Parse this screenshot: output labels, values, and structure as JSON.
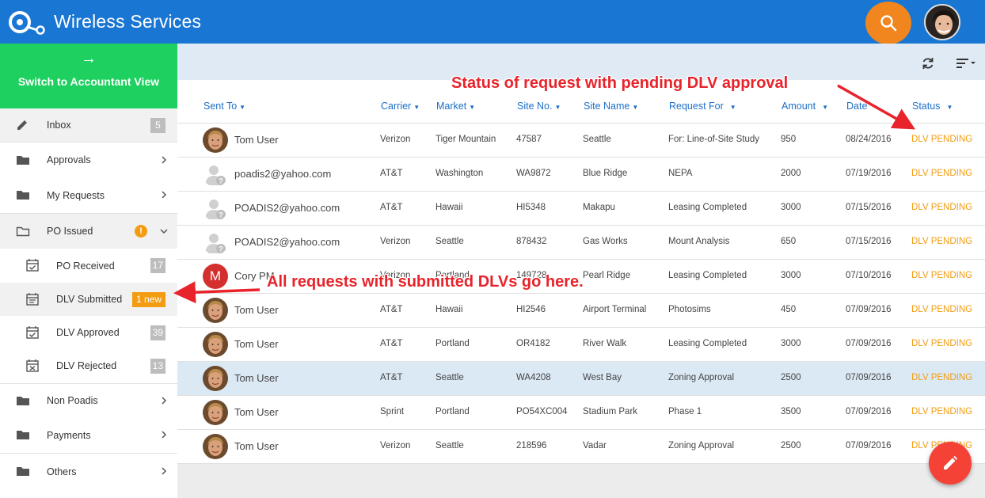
{
  "app": {
    "title": "Wireless Services"
  },
  "sidebar": {
    "switch_label": "Switch to Accountant View",
    "switch_arrow": "→",
    "items": [
      {
        "label": "Inbox",
        "count": "5"
      },
      {
        "label": "Approvals"
      },
      {
        "label": "My Requests"
      },
      {
        "label": "PO Issued",
        "warning": "!"
      },
      {
        "label": "PO Received",
        "count": "17"
      },
      {
        "label": "DLV Submitted",
        "badge": "1 new"
      },
      {
        "label": "DLV Approved",
        "count": "39"
      },
      {
        "label": "DLV Rejected",
        "count": "13"
      },
      {
        "label": "Non Poadis"
      },
      {
        "label": "Payments"
      },
      {
        "label": "Others"
      }
    ]
  },
  "table": {
    "columns": [
      "Sent To",
      "Carrier",
      "Market",
      "Site No.",
      "Site Name",
      "Request For",
      "Amount",
      "Date",
      "Status"
    ],
    "rows": [
      {
        "sent_to": "Tom User",
        "avatar": "photo",
        "carrier": "Verizon",
        "market": "Tiger Mountain",
        "site_no": "47587",
        "site_name": "Seattle",
        "request_for": "For: Line-of-Site Study",
        "amount": "950",
        "date": "08/24/2016",
        "status": "DLV PENDING"
      },
      {
        "sent_to": "poadis2@yahoo.com",
        "avatar": "placeholder",
        "carrier": "AT&T",
        "market": "Washington",
        "site_no": "WA9872",
        "site_name": "Blue Ridge",
        "request_for": "NEPA",
        "amount": "2000",
        "date": "07/19/2016",
        "status": "DLV PENDING"
      },
      {
        "sent_to": "POADIS2@yahoo.com",
        "avatar": "placeholder",
        "carrier": "AT&T",
        "market": "Hawaii",
        "site_no": "HI5348",
        "site_name": "Makapu",
        "request_for": "Leasing Completed",
        "amount": "3000",
        "date": "07/15/2016",
        "status": "DLV PENDING"
      },
      {
        "sent_to": "POADIS2@yahoo.com",
        "avatar": "placeholder",
        "carrier": "Verizon",
        "market": "Seattle",
        "site_no": "878432",
        "site_name": "Gas Works",
        "request_for": "Mount Analysis",
        "amount": "650",
        "date": "07/15/2016",
        "status": "DLV PENDING"
      },
      {
        "sent_to": "Cory PM",
        "avatar": "M",
        "carrier": "Verizon",
        "market": "Portland",
        "site_no": "149728",
        "site_name": "Pearl Ridge",
        "request_for": "Leasing Completed",
        "amount": "3000",
        "date": "07/10/2016",
        "status": "DLV PENDING"
      },
      {
        "sent_to": "Tom User",
        "avatar": "photo",
        "carrier": "AT&T",
        "market": "Hawaii",
        "site_no": "HI2546",
        "site_name": "Airport Terminal",
        "request_for": "Photosims",
        "amount": "450",
        "date": "07/09/2016",
        "status": "DLV PENDING"
      },
      {
        "sent_to": "Tom User",
        "avatar": "photo",
        "carrier": "AT&T",
        "market": "Portland",
        "site_no": "OR4182",
        "site_name": "River Walk",
        "request_for": "Leasing Completed",
        "amount": "3000",
        "date": "07/09/2016",
        "status": "DLV PENDING"
      },
      {
        "sent_to": "Tom User",
        "avatar": "photo",
        "carrier": "AT&T",
        "market": "Seattle",
        "site_no": "WA4208",
        "site_name": "West Bay",
        "request_for": "Zoning Approval",
        "amount": "2500",
        "date": "07/09/2016",
        "status": "DLV PENDING"
      },
      {
        "sent_to": "Tom User",
        "avatar": "photo",
        "carrier": "Sprint",
        "market": "Portland",
        "site_no": "PO54XC004",
        "site_name": "Stadium Park",
        "request_for": "Phase 1",
        "amount": "3500",
        "date": "07/09/2016",
        "status": "DLV PENDING"
      },
      {
        "sent_to": "Tom User",
        "avatar": "photo",
        "carrier": "Verizon",
        "market": "Seattle",
        "site_no": "218596",
        "site_name": "Vadar",
        "request_for": "Zoning Approval",
        "amount": "2500",
        "date": "07/09/2016",
        "status": "DLV PENDING"
      }
    ]
  },
  "annotations": {
    "status_note": "Status of request with pending DLV approval",
    "dlv_note": "All requests with submitted DLVs go here."
  },
  "colors": {
    "header": "#1976d2",
    "switch_bg": "#1ed05f",
    "search_btn": "#f0861d",
    "status": "#f39c12",
    "fab": "#f44336",
    "annotation": "#e8232b"
  },
  "icons": [
    "logo-icon",
    "search-icon",
    "pencil-icon",
    "folder-icon",
    "folder-open-icon",
    "calendar-check-icon",
    "calendar-list-icon",
    "calendar-x-icon",
    "chevron-right-icon",
    "chevron-down-icon",
    "refresh-icon",
    "sort-icon",
    "edit-icon"
  ]
}
